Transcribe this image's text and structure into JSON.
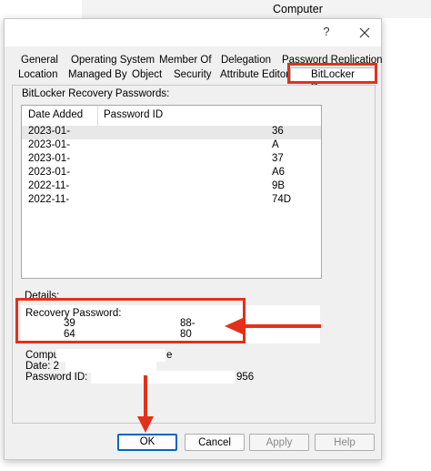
{
  "background_window": {
    "title": "Computer"
  },
  "dialog": {
    "help_glyph": "?",
    "close_glyph": "✕"
  },
  "tabs": {
    "row1": [
      "General",
      "Operating System",
      "Member Of",
      "Delegation",
      "Password Replication"
    ],
    "row2": [
      "Location",
      "Managed By",
      "Object",
      "Security",
      "Attribute Editor",
      "BitLocker Recovery"
    ],
    "active": "BitLocker Recovery"
  },
  "panel": {
    "list_label": "BitLocker Recovery Passwords:",
    "columns": [
      "Date Added",
      "Password ID"
    ],
    "rows": [
      {
        "date": "2023-01-",
        "id_tail": "36"
      },
      {
        "date": "2023-01-",
        "id_tail": "A"
      },
      {
        "date": "2023-01-",
        "id_tail": "37"
      },
      {
        "date": "2023-01-",
        "id_tail": "A6"
      },
      {
        "date": "2022-11-",
        "id_tail": "9B"
      },
      {
        "date": "2022-11-",
        "id_tail": "74D"
      }
    ],
    "details_label": "Details:",
    "recovery_password_label": "Recovery Password:",
    "recovery_line1_start": "39",
    "recovery_line1_end": "88-",
    "recovery_line2_start": "64",
    "recovery_line2_end": "80",
    "computer_line_start": "Compu",
    "computer_line_end": "e",
    "date_line": "Date: 2",
    "password_id_start": "Password ID: 6!",
    "password_id_end": "956"
  },
  "buttons": {
    "ok": "OK",
    "cancel": "Cancel",
    "apply": "Apply",
    "help": "Help"
  },
  "colors": {
    "annotation_red": "#e2311a",
    "default_button_border": "#0067c0"
  }
}
